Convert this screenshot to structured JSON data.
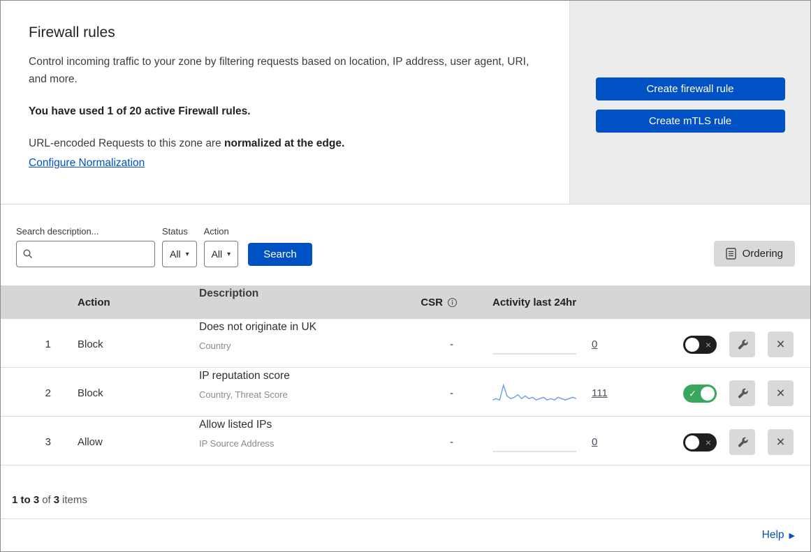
{
  "header": {
    "title": "Firewall rules",
    "description": "Control incoming traffic to your zone by filtering requests based on location, IP address, user agent, URI, and more.",
    "usage": "You have used 1 of 20 active Firewall rules.",
    "normalization_prefix": "URL-encoded Requests to this zone are ",
    "normalization_bold": "normalized at the edge.",
    "normalization_link": "Configure Normalization",
    "buttons": {
      "create_firewall": "Create firewall rule",
      "create_mtls": "Create mTLS rule"
    }
  },
  "filters": {
    "search_label": "Search description...",
    "status_label": "Status",
    "status_value": "All",
    "action_label": "Action",
    "action_value": "All",
    "search_button": "Search",
    "ordering_button": "Ordering"
  },
  "table": {
    "columns": {
      "action": "Action",
      "description": "Description",
      "csr": "CSR",
      "activity": "Activity last 24hr"
    },
    "rows": [
      {
        "num": "1",
        "action": "Block",
        "description": "Does not originate in UK",
        "criteria": "Country",
        "csr": "-",
        "activity_count": "0",
        "enabled": false,
        "sparkline": []
      },
      {
        "num": "2",
        "action": "Block",
        "description": "IP reputation score",
        "criteria": "Country, Threat Score",
        "csr": "-",
        "activity_count": "111",
        "enabled": true,
        "sparkline": [
          2,
          3,
          2,
          13,
          5,
          3,
          4,
          6,
          3,
          5,
          3,
          4,
          2,
          3,
          4,
          2,
          3,
          2,
          4,
          3,
          2,
          3,
          4,
          3
        ]
      },
      {
        "num": "3",
        "action": "Allow",
        "description": "Allow listed IPs",
        "criteria": "IP Source Address",
        "csr": "-",
        "activity_count": "0",
        "enabled": false,
        "sparkline": []
      }
    ],
    "footer": {
      "range": "1 to 3",
      "of": "of",
      "total": "3",
      "items_label": "items"
    }
  },
  "help": {
    "label": "Help"
  },
  "chart_data": {
    "type": "line",
    "title": "Activity last 24hr sparkline (rule 2)",
    "x": "24 hourly buckets",
    "values": [
      2,
      3,
      2,
      13,
      5,
      3,
      4,
      6,
      3,
      5,
      3,
      4,
      2,
      3,
      4,
      2,
      3,
      2,
      4,
      3,
      2,
      3,
      4,
      3
    ],
    "total": 111
  },
  "colors": {
    "accent_blue": "#0051c3",
    "toggle_on_green": "#3aa55d",
    "toggle_off_black": "#1f1f1f",
    "sparkline_blue": "#6d9ee6",
    "panel_gray": "#ececec",
    "table_header_gray": "#d6d6d6"
  }
}
